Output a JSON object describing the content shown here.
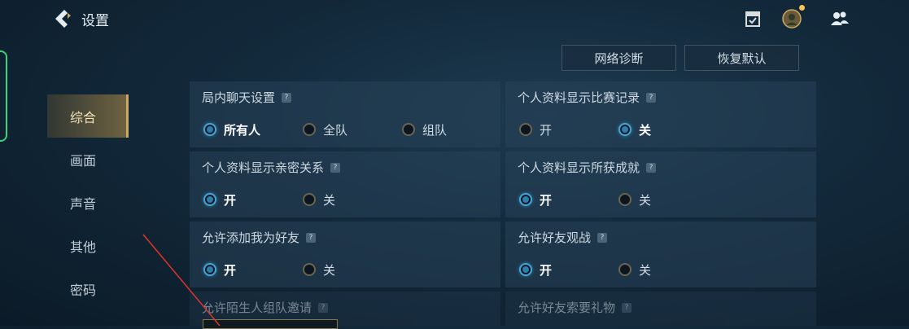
{
  "header": {
    "title": "设置",
    "icons": [
      "back-chevron-icon",
      "mission-flag-icon",
      "profile-avatar-icon",
      "friends-icon"
    ]
  },
  "actions": {
    "network_label": "网络诊断",
    "reset_label": "恢复默认"
  },
  "sidebar": {
    "items": [
      {
        "label": "综合",
        "active": true
      },
      {
        "label": "画面"
      },
      {
        "label": "声音"
      },
      {
        "label": "其他"
      },
      {
        "label": "密码"
      }
    ]
  },
  "sections": [
    {
      "title": "局内聊天设置",
      "options": [
        "所有人",
        "全队",
        "组队"
      ],
      "selected": 0
    },
    {
      "title": "个人资料显示比赛记录",
      "options": [
        "开",
        "关"
      ],
      "selected": 1
    },
    {
      "title": "个人资料显示亲密关系",
      "options": [
        "开",
        "关"
      ],
      "selected": 0
    },
    {
      "title": "个人资料显示所获成就",
      "options": [
        "开",
        "关"
      ],
      "selected": 0
    },
    {
      "title": "允许添加我为好友",
      "options": [
        "开",
        "关"
      ],
      "selected": 0
    },
    {
      "title": "允许好友观战",
      "options": [
        "开",
        "关"
      ],
      "selected": 0
    },
    {
      "title": "允许陌生人组队邀请",
      "options": []
    },
    {
      "title": "允许好友索要礼物",
      "options": []
    }
  ],
  "help_glyph": "?",
  "colors": {
    "accent_blue": "#3fa7d9",
    "active_tab_gold": "#c9a962",
    "annotation_red": "#e0342a",
    "edge_green": "#3bd37a"
  }
}
